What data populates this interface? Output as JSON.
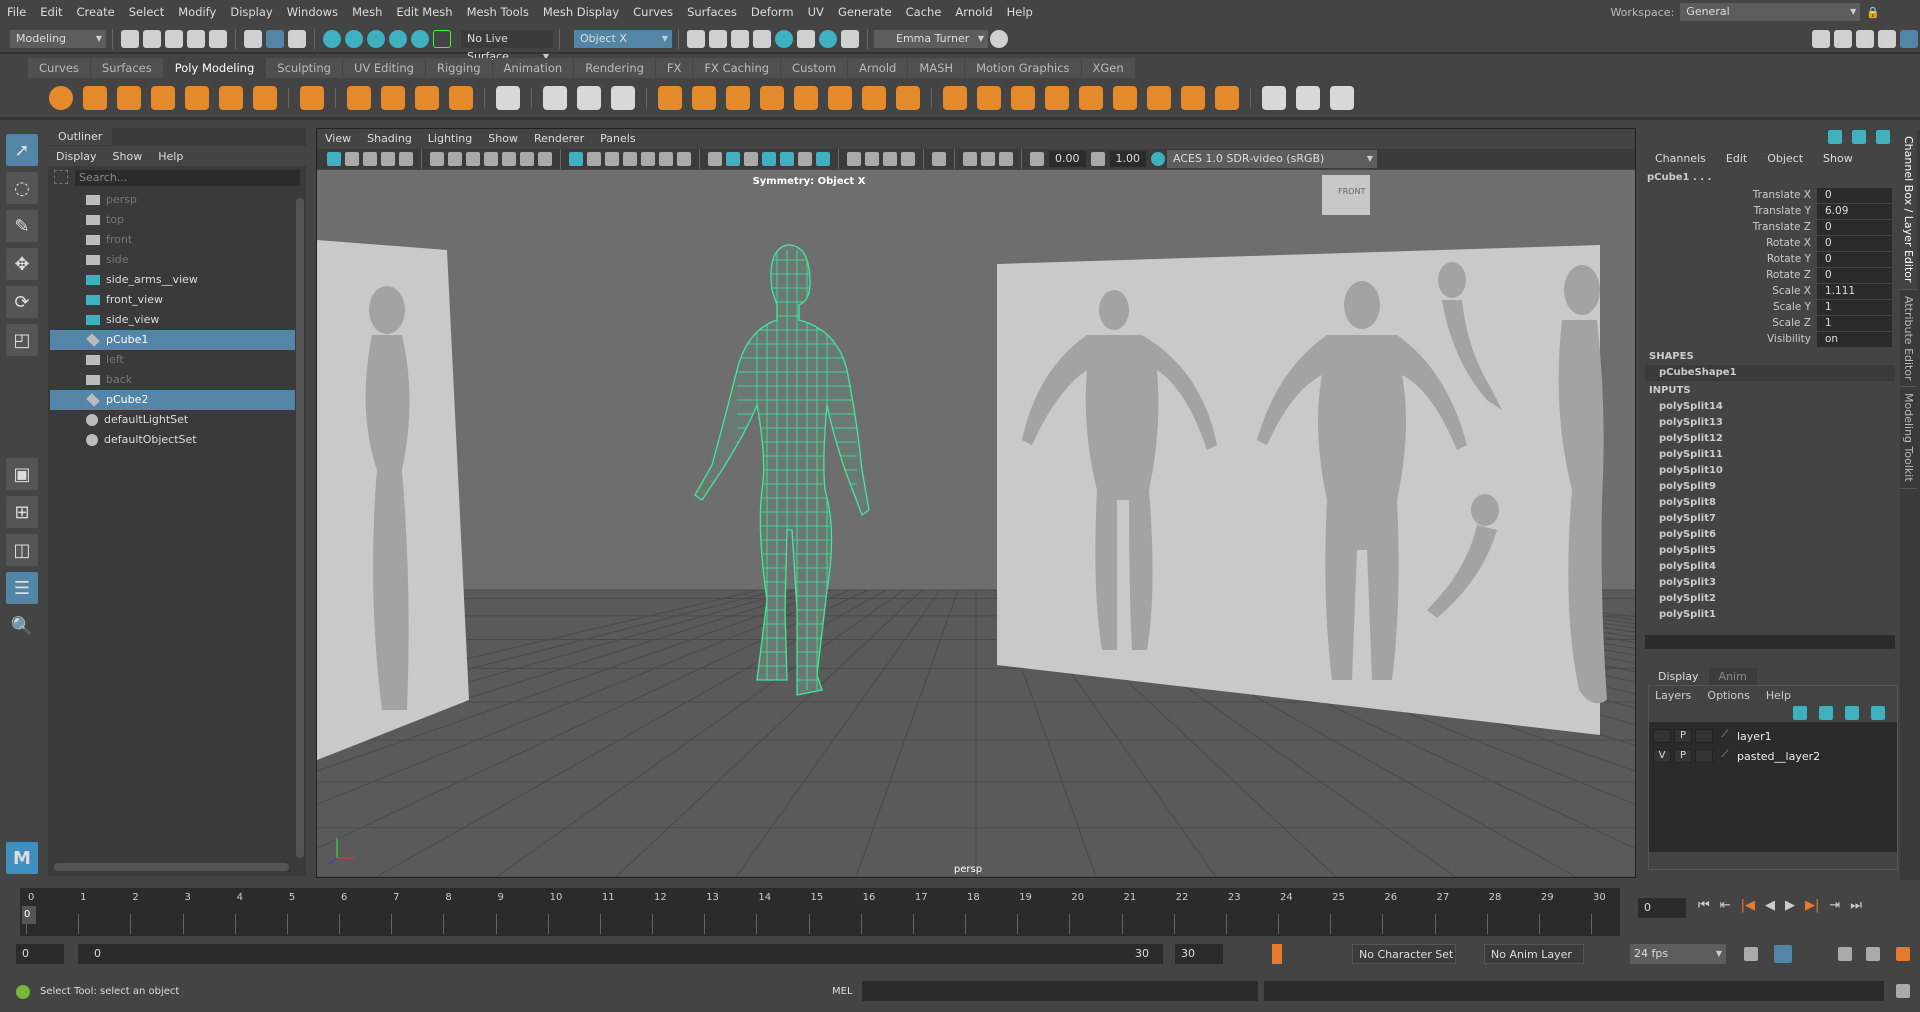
{
  "menubar": [
    "File",
    "Edit",
    "Create",
    "Select",
    "Modify",
    "Display",
    "Windows",
    "Mesh",
    "Edit Mesh",
    "Mesh Tools",
    "Mesh Display",
    "Curves",
    "Surfaces",
    "Deform",
    "UV",
    "Generate",
    "Cache",
    "Arnold",
    "Help"
  ],
  "workspace": {
    "label": "Workspace:",
    "value": "General"
  },
  "statusline": {
    "mode": "Modeling",
    "live_surface": "No Live Surface",
    "symmetry": "Object X",
    "user": "Emma Turner"
  },
  "shelf_tabs": [
    "Curves",
    "Surfaces",
    "Poly Modeling",
    "Sculpting",
    "UV Editing",
    "Rigging",
    "Animation",
    "Rendering",
    "FX",
    "FX Caching",
    "Custom",
    "Arnold",
    "MASH",
    "Motion Graphics",
    "XGen"
  ],
  "shelf_active": "Poly Modeling",
  "outliner": {
    "title": "Outliner",
    "menu": [
      "Display",
      "Show",
      "Help"
    ],
    "search_placeholder": "Search...",
    "items": [
      {
        "name": "persp",
        "type": "camera",
        "dim": true
      },
      {
        "name": "top",
        "type": "camera",
        "dim": true
      },
      {
        "name": "front",
        "type": "camera",
        "dim": true
      },
      {
        "name": "side",
        "type": "camera",
        "dim": true
      },
      {
        "name": "side_arms__view",
        "type": "imageplane"
      },
      {
        "name": "front_view",
        "type": "imageplane"
      },
      {
        "name": "side_view",
        "type": "imageplane"
      },
      {
        "name": "pCube1",
        "type": "mesh",
        "selected": true
      },
      {
        "name": "left",
        "type": "camera",
        "dim": true
      },
      {
        "name": "back",
        "type": "camera",
        "dim": true
      },
      {
        "name": "pCube2",
        "type": "mesh",
        "selected": true
      },
      {
        "name": "defaultLightSet",
        "type": "set"
      },
      {
        "name": "defaultObjectSet",
        "type": "set"
      }
    ]
  },
  "viewport": {
    "menu": [
      "View",
      "Shading",
      "Lighting",
      "Show",
      "Renderer",
      "Panels"
    ],
    "exposure": "0.00",
    "gamma": "1.00",
    "colorspace": "ACES 1.0 SDR-video (sRGB)",
    "symmetry_label": "Symmetry: Object X",
    "camera_label": "persp",
    "viewcube_label": "FRONT",
    "wire_color": "#3fe8a0"
  },
  "channelbox": {
    "menu": [
      "Channels",
      "Edit",
      "Object",
      "Show"
    ],
    "object": "pCube1 . . .",
    "attrs": [
      [
        "Translate X",
        "0"
      ],
      [
        "Translate Y",
        "6.09"
      ],
      [
        "Translate Z",
        "0"
      ],
      [
        "Rotate X",
        "0"
      ],
      [
        "Rotate Y",
        "0"
      ],
      [
        "Rotate Z",
        "0"
      ],
      [
        "Scale X",
        "1.111"
      ],
      [
        "Scale Y",
        "1"
      ],
      [
        "Scale Z",
        "1"
      ],
      [
        "Visibility",
        "on"
      ]
    ],
    "shapes_label": "SHAPES",
    "shape": "pCubeShape1",
    "inputs_label": "INPUTS",
    "inputs": [
      "polySplit14",
      "polySplit13",
      "polySplit12",
      "polySplit11",
      "polySplit10",
      "polySplit9",
      "polySplit8",
      "polySplit7",
      "polySplit6",
      "polySplit5",
      "polySplit4",
      "polySplit3",
      "polySplit2",
      "polySplit1"
    ]
  },
  "side_tabs": [
    "Channel Box / Layer Editor",
    "Attribute Editor",
    "Modeling Toolkit"
  ],
  "layers": {
    "tabs": [
      "Display",
      "Anim"
    ],
    "menu": [
      "Layers",
      "Options",
      "Help"
    ],
    "rows": [
      {
        "v": "",
        "p": "P",
        "name": "layer1"
      },
      {
        "v": "V",
        "p": "P",
        "name": "pasted__layer2"
      }
    ]
  },
  "timeline": {
    "ticks": [
      "0",
      "1",
      "2",
      "3",
      "4",
      "5",
      "6",
      "7",
      "8",
      "9",
      "10",
      "11",
      "12",
      "13",
      "14",
      "15",
      "16",
      "17",
      "18",
      "19",
      "20",
      "21",
      "22",
      "23",
      "24",
      "25",
      "26",
      "27",
      "28",
      "29",
      "30"
    ],
    "current": "0",
    "current_field": "0"
  },
  "range": {
    "start": "0",
    "inner_start": "0",
    "inner_end": "30",
    "end": "30",
    "character_set": "No Character Set",
    "anim_layer": "No Anim Layer",
    "fps": "24 fps"
  },
  "commandline": {
    "help": "Select Tool: select an object",
    "lang": "MEL"
  }
}
